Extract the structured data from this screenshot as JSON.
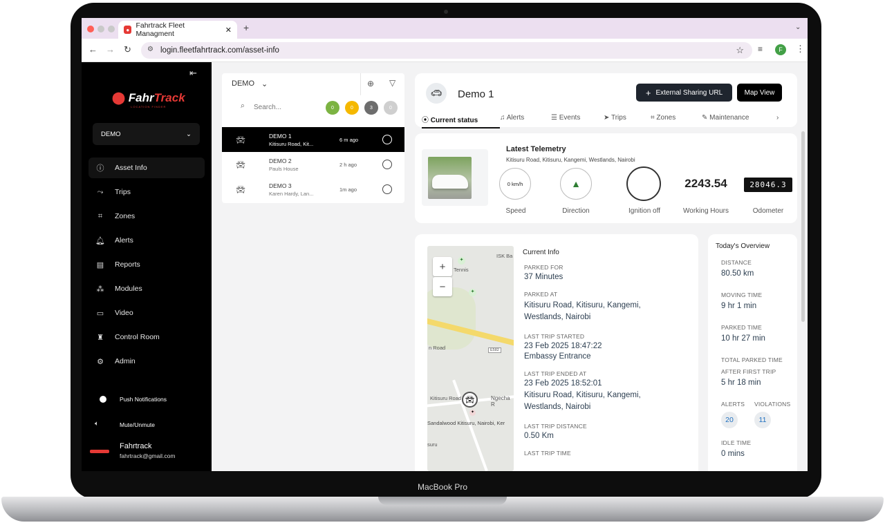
{
  "browser": {
    "tab_title": "Fahrtrack Fleet Managment",
    "url": "login.fleetfahrtrack.com/asset-info",
    "profile_initial": "F"
  },
  "device": {
    "label": "MacBook Pro"
  },
  "sidebar": {
    "logo_word_a": "Fahr",
    "logo_word_b": "Track",
    "logo_tagline": "LOCATION FINDER",
    "account": "DEMO",
    "items": [
      {
        "label": "Asset Info",
        "icon": "info-icon"
      },
      {
        "label": "Trips",
        "icon": "route-icon"
      },
      {
        "label": "Zones",
        "icon": "zones-icon"
      },
      {
        "label": "Alerts",
        "icon": "bell-icon"
      },
      {
        "label": "Reports",
        "icon": "report-icon"
      },
      {
        "label": "Modules",
        "icon": "modules-icon"
      },
      {
        "label": "Video",
        "icon": "video-icon"
      },
      {
        "label": "Control Room",
        "icon": "control-room-icon"
      },
      {
        "label": "Admin",
        "icon": "gear-icon"
      }
    ],
    "push_notifications": "Push Notifications",
    "mute": "Mute/Unmute",
    "user_name": "Fahrtrack",
    "user_email": "fahrtrack@gmail.com"
  },
  "assetlist": {
    "group": "DEMO",
    "search_placeholder": "Search...",
    "badges": [
      {
        "count": "0",
        "color": "#7cb342"
      },
      {
        "count": "0",
        "color": "#f5b800"
      },
      {
        "count": "3",
        "color": "#6d6d6d"
      },
      {
        "count": "0",
        "color": "#cfcfcf"
      }
    ],
    "rows": [
      {
        "name": "DEMO 1",
        "sub": "Kitisuru Road, Kit...",
        "time": "6 m ago"
      },
      {
        "name": "DEMO 2",
        "sub": "Pauls House",
        "time": "2 h ago"
      },
      {
        "name": "DEMO 3",
        "sub": "Karen Hardy, Lan...",
        "time": "1m ago"
      }
    ]
  },
  "detail": {
    "name": "Demo 1",
    "share_btn": "External Sharing URL",
    "map_btn": "Map View",
    "tabs": [
      "Current status",
      "Alerts",
      "Events",
      "Trips",
      "Zones",
      "Maintenance"
    ],
    "telemetry": {
      "title": "Latest Telemetry",
      "address": "Kitisuru Road, Kitisuru, Kangemi, Westlands, Nairobi",
      "speed_value": "0 km/h",
      "speed_label": "Speed",
      "direction_label": "Direction",
      "ignition_label": "Ignition off",
      "hours_value": "2243.54",
      "hours_label": "Working Hours",
      "odometer_value": "28046.3",
      "odometer_label": "Odometer"
    },
    "map": {
      "labels": [
        "Tennis",
        "ISK Ba",
        "n Road",
        "E582",
        "Kitisuru Road",
        "Ngecha R",
        "Sandalwood Kitisuru, Nairobi, Ker",
        "suru"
      ]
    },
    "current_info": {
      "title": "Current Info",
      "fields": [
        {
          "label": "PARKED FOR",
          "value": "37 Minutes"
        },
        {
          "label": "PARKED AT",
          "value": "Kitisuru Road, Kitisuru, Kangemi, Westlands, Nairobi"
        },
        {
          "label": "LAST TRIP STARTED",
          "value": "23 Feb 2025 18:47:22",
          "value2": "Embassy Entrance"
        },
        {
          "label": "LAST TRIP ENDED AT",
          "value": "23 Feb 2025 18:52:01",
          "value2": "Kitisuru Road, Kitisuru, Kangemi, Westlands, Nairobi"
        },
        {
          "label": "LAST TRIP DISTANCE",
          "value": "0.50 Km"
        },
        {
          "label": "LAST TRIP TIME",
          "value": ""
        }
      ]
    },
    "overview": {
      "title": "Today's Overview",
      "distance_label": "DISTANCE",
      "distance": "80.50 km",
      "moving_label": "MOVING TIME",
      "moving": "9 hr 1 min",
      "parked_label": "PARKED TIME",
      "parked": "10 hr 27 min",
      "total_parked_label": "TOTAL PARKED TIME",
      "after_first_label": "AFTER FIRST TRIP",
      "after_first": "5 hr 18 min",
      "alerts_label": "ALERTS",
      "alerts": "20",
      "violations_label": "VIOLATIONS",
      "violations": "11",
      "idle_label": "IDLE TIME",
      "idle": "0 mins"
    }
  }
}
